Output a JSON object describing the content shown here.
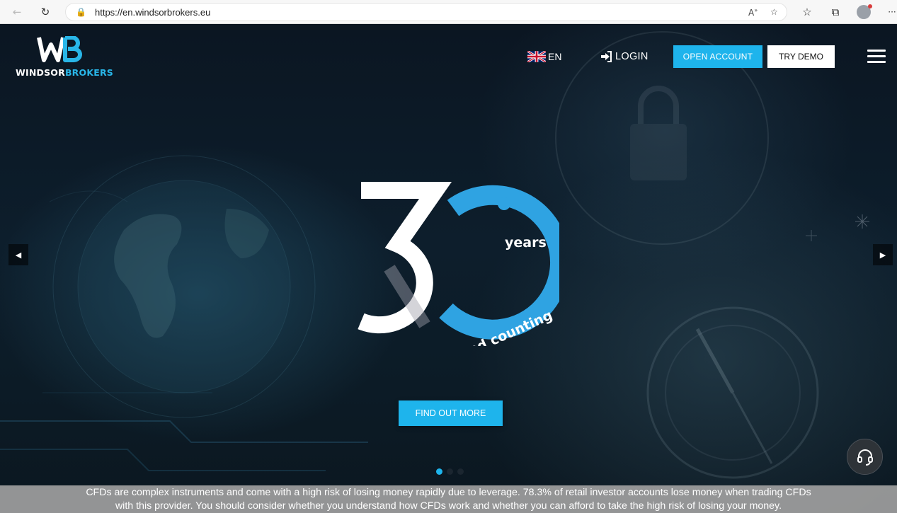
{
  "browser": {
    "back_icon": "back-arrow-icon",
    "reload_icon": "reload-icon",
    "url": "https://en.windsorbrokers.eu",
    "read_aloud_label": "A",
    "toolbar_icons": [
      "read-aloud-icon",
      "add-favorite-icon",
      "favorites-icon",
      "collections-icon",
      "profile-avatar",
      "more-menu-icon"
    ],
    "more_label": "···"
  },
  "header": {
    "logo_part1": "WINDSOR",
    "logo_part2": "BROKERS",
    "language": "EN",
    "login_label": "LOGIN",
    "open_account_label": "OPEN ACCOUNT",
    "try_demo_label": "TRY DEMO"
  },
  "hero": {
    "number": "30",
    "years_label": "years",
    "counting_label": "and counting",
    "cta_label": "FIND OUT MORE",
    "slides": 3,
    "active_slide": 1
  },
  "risk_warning": {
    "line1": "CFDs are complex instruments and come with a high risk of losing money rapidly due to leverage. 78.3% of retail investor accounts lose money when trading CFDs",
    "line2": "with this provider. You should consider whether you understand how CFDs work and whether you can afford to take the high risk of losing your money."
  },
  "colors": {
    "accent": "#1eb4ec",
    "background": "#0b1622",
    "risk_bar": "#a0a0a0"
  }
}
